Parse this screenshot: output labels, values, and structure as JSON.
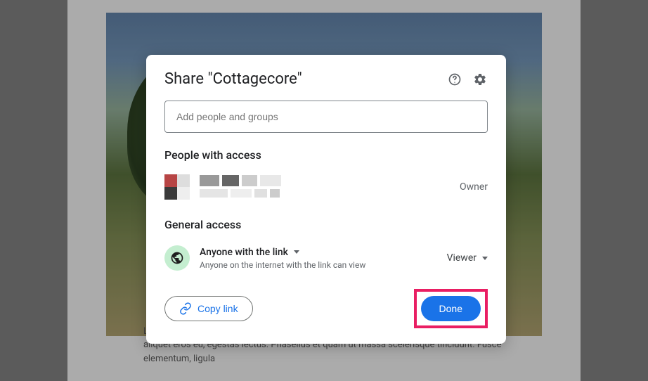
{
  "dialog": {
    "title": "Share \"Cottagecore\"",
    "input_placeholder": "Add people and groups",
    "sections": {
      "people_title": "People with access",
      "general_title": "General access"
    },
    "owner_role": "Owner",
    "general": {
      "scope": "Anyone with the link",
      "description": "Anyone on the internet with the link can view",
      "permission": "Viewer"
    },
    "buttons": {
      "copy_link": "Copy link",
      "done": "Done"
    }
  },
  "background": {
    "lorem": "Lorem ipsum dolor sit amet, consectetur adipiscing elit. Phasellus at justo gravida, aliquet eros eu, egestas lectus. Phasellus et quam ut massa scelerisque tincidunt. Fusce elementum, ligula"
  }
}
